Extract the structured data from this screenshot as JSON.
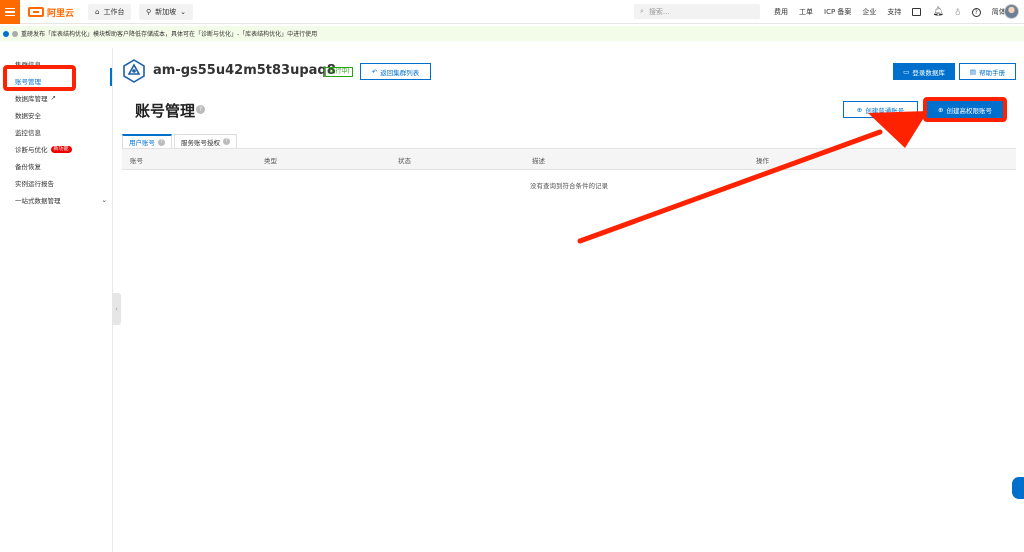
{
  "header": {
    "logo_text": "阿里云",
    "workbench_label": "工作台",
    "region_label": "新加坡",
    "search_placeholder": "搜索...",
    "nav": [
      "费用",
      "工单",
      "ICP 备案",
      "企业",
      "支持"
    ],
    "lang_label": "简体"
  },
  "notice": {
    "text": "重磅发布「库表结构优化」模块帮助客户降低存储成本，具体可在「诊断与优化」-「库表结构优化」中进行使用"
  },
  "sidebar": {
    "items": [
      {
        "label": "集群信息"
      },
      {
        "label": "账号管理"
      },
      {
        "label": "数据库管理"
      },
      {
        "label": "数据安全"
      },
      {
        "label": "监控信息"
      },
      {
        "label": "诊断与优化"
      },
      {
        "label": "备份恢复"
      },
      {
        "label": "实例运行报告"
      },
      {
        "label": "一站式数据管理"
      }
    ],
    "badge": "新功能"
  },
  "cluster": {
    "name": "am-gs55u42m5t83upaq8",
    "status": "(运行中)",
    "back_button": "返回集群列表",
    "login_db_button": "登录数据库",
    "help_button": "帮助手册"
  },
  "page": {
    "title": "账号管理",
    "create_normal_button": "创建普通账号",
    "create_admin_button": "创建高权限账号"
  },
  "tabs": [
    {
      "label": "用户账号"
    },
    {
      "label": "服务账号授权"
    }
  ],
  "table": {
    "columns": [
      "账号",
      "类型",
      "状态",
      "描述",
      "操作"
    ],
    "empty_text": "没有查询到符合条件的记录"
  },
  "colors": {
    "brand": "#ff6a00",
    "primary": "#0070cc",
    "annotation_red": "#ff2200",
    "notice_bg": "#f3fbe9"
  }
}
